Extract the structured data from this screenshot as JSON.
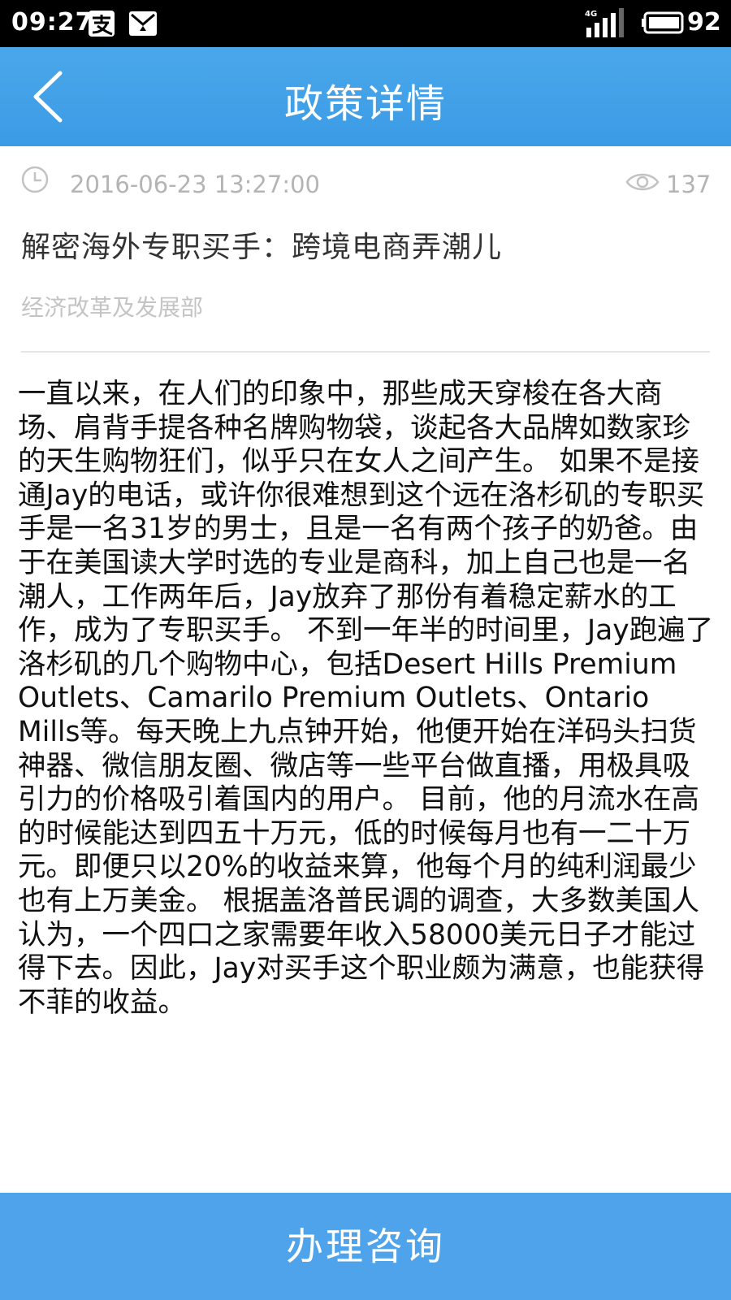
{
  "status_bar": {
    "time": "09:27",
    "network": "4G",
    "battery": "92",
    "icons": [
      "alipay-notification-icon",
      "message-notification-icon",
      "signal-icon",
      "battery-icon"
    ]
  },
  "header": {
    "title": "政策详情",
    "back_icon": "chevron-left-icon"
  },
  "article": {
    "date": "2016-06-23 13:27:00",
    "views": "137",
    "title": "解密海外专职买手：跨境电商弄潮儿",
    "department": "经济改革及发展部",
    "body": "一直以来，在人们的印象中，那些成天穿梭在各大商场、肩背手提各种名牌购物袋，谈起各大品牌如数家珍的天生购物狂们，似乎只在女人之间产生。 如果不是接通Jay的电话，或许你很难想到这个远在洛杉矶的专职买手是一名31岁的男士，且是一名有两个孩子的奶爸。由于在美国读大学时选的专业是商科，加上自己也是一名潮人，工作两年后，Jay放弃了那份有着稳定薪水的工作，成为了专职买手。 不到一年半的时间里，Jay跑遍了洛杉矶的几个购物中心，包括Desert Hills Premium Outlets、Camarilo Premium Outlets、Ontario Mills等。每天晚上九点钟开始，他便开始在洋码头扫货神器、微信朋友圈、微店等一些平台做直播，用极具吸引力的价格吸引着国内的用户。 目前，他的月流水在高的时候能达到四五十万元，低的时候每月也有一二十万元。即便只以20%的收益来算，他每个月的纯利润最少也有上万美金。 根据盖洛普民调的调查，大多数美国人认为，一个四口之家需要年收入58000美元日子才能过得下去。因此，Jay对买手这个职业颇为满意，也能获得不菲的收益。"
  },
  "footer": {
    "button_label": "办理咨询"
  },
  "colors": {
    "header_blue": "#3b9be5",
    "footer_blue": "#4ea3ea",
    "meta_gray": "#b4b4b4"
  }
}
